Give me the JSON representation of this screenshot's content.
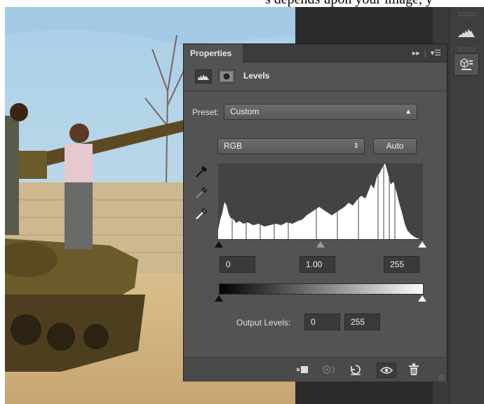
{
  "caption": "s depends upon your image, y",
  "panel": {
    "tab_label": "Properties",
    "title": "Levels",
    "preset_label": "Preset:",
    "preset_value": "Custom",
    "channel_value": "RGB",
    "auto_label": "Auto",
    "input_levels": {
      "black": "0",
      "gamma": "1.00",
      "white": "255"
    },
    "output_label": "Output Levels:",
    "output_levels": {
      "black": "0",
      "white": "255"
    }
  },
  "icons": {
    "tab_controls": [
      "collapse-icon",
      "panel-menu-icon"
    ],
    "header": [
      "histogram-icon",
      "mask-icon"
    ],
    "eyedroppers": [
      "black-point-eyedropper-icon",
      "gray-point-eyedropper-icon",
      "white-point-eyedropper-icon"
    ],
    "footer": [
      "clip-to-layer-icon",
      "view-previous-icon",
      "reset-icon",
      "visibility-eye-icon",
      "delete-icon"
    ],
    "dock": [
      "histogram-dock-icon",
      "properties-dock-icon"
    ]
  },
  "colors": {
    "panel_bg": "#535353",
    "histogram_bg": "#434343",
    "histogram_fill": "#ffffff"
  }
}
